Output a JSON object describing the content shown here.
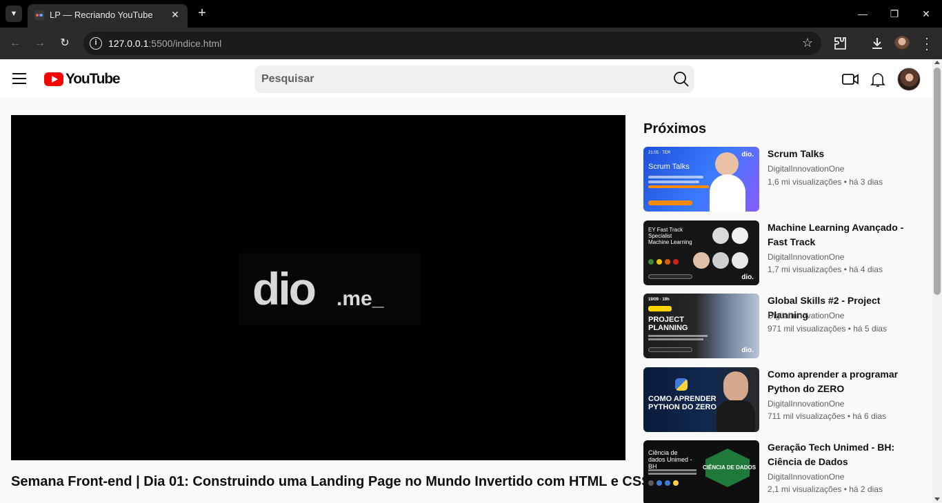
{
  "browser": {
    "tab_title": "LP — Recriando YouTube",
    "url_host": "127.0.0.1",
    "url_rest": ":5500/indice.html"
  },
  "header": {
    "logo_text": "YouTube",
    "search_placeholder": "Pesquisar"
  },
  "video": {
    "player_logo": "dio",
    "player_logo_suffix": ".me_",
    "title": "Semana Front-end | Dia 01: Construindo uma Landing Page no Mundo Invertido com HTML e CSS"
  },
  "up_next": {
    "title": "Próximos",
    "items": [
      {
        "title": "Scrum Talks",
        "channel": "DigitalInnovationOne",
        "meta": "1,6 mi visualizações • há 3 dias",
        "thumb_text": "Scrum Talks",
        "thumb_time": "21:05 · TER"
      },
      {
        "title": "Machine Learning Avançado - Fast Track",
        "channel": "DigitalInnovationOne",
        "meta": "1,7 mi visualizações • há 4 dias",
        "thumb_text": "EY Fast Track Specialist Machine Learning"
      },
      {
        "title": "Global Skills #2 - Project Planning",
        "channel": "DigitalInnovationOne",
        "meta": "971 mil visualizações • há 5 dias",
        "thumb_text": "PROJECT PLANNING",
        "thumb_time": "19/09 · 19h"
      },
      {
        "title": "Como aprender a programar Python do ZERO",
        "channel": "DigitalInnovationOne",
        "meta": "711 mil visualizações • há 6 dias",
        "thumb_text": "COMO APRENDER PYTHON DO ZERO"
      },
      {
        "title": "Geração Tech Unimed - BH: Ciência de Dados",
        "channel": "DigitalInnovationOne",
        "meta": "2,1 mi visualizações • há 2 dias",
        "thumb_text": "Ciência de dados Unimed - BH",
        "thumb_badge": "CIÊNCIA DE DADOS"
      }
    ]
  },
  "colors": {
    "brand_red": "#ff0000",
    "page_bg": "#f9f9f9",
    "text_primary": "#0f0f0f",
    "text_secondary": "#606060"
  }
}
